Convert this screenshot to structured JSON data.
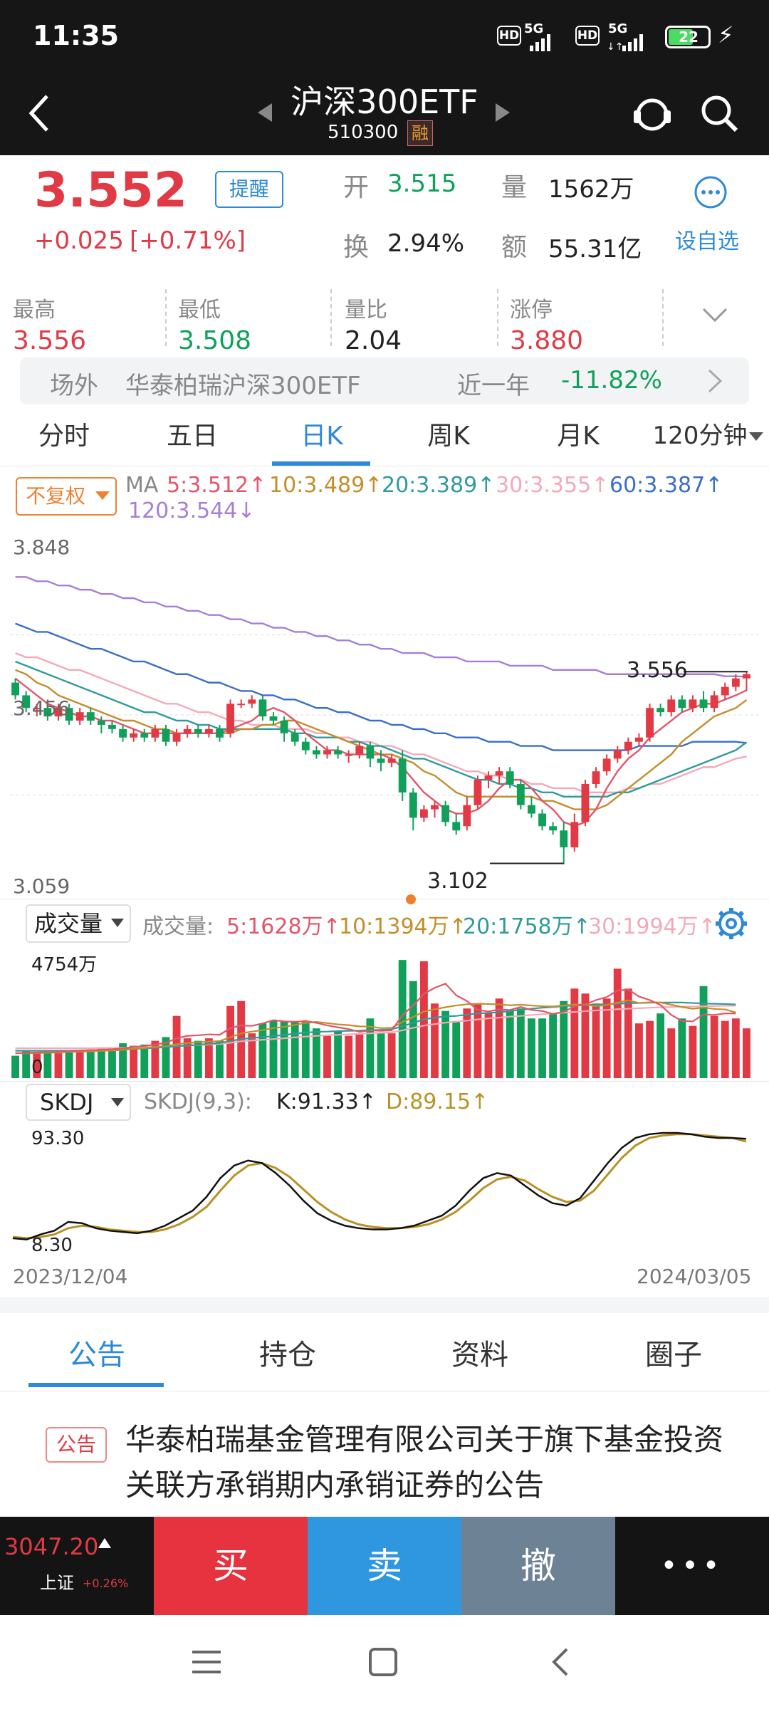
{
  "status_bar": {
    "time": "11:35",
    "signal1": "5G",
    "signal2": "5G",
    "hd": "HD",
    "battery": "22"
  },
  "header": {
    "title": "沪深300ETF",
    "code": "510300",
    "margin_badge": "融"
  },
  "quote": {
    "price": "3.552",
    "remind_button": "提醒",
    "change": "+0.025",
    "change_pct": "[+0.71%]",
    "open_label": "开",
    "open_value": "3.515",
    "volume_label": "量",
    "volume_value": "1562万",
    "turnover_label": "换",
    "turnover_value": "2.94%",
    "amount_label": "额",
    "amount_value": "55.31亿",
    "watchlist_label": "设自选"
  },
  "stats": [
    {
      "label": "最高",
      "value": "3.556",
      "color": "#e23a45"
    },
    {
      "label": "最低",
      "value": "3.508",
      "color": "#10a05a"
    },
    {
      "label": "量比",
      "value": "2.04",
      "color": "#222222"
    },
    {
      "label": "涨停",
      "value": "3.880",
      "color": "#e23a45"
    }
  ],
  "offsite": {
    "label": "场外",
    "name": "华泰柏瑞沪深300ETF",
    "period": "近一年",
    "return": "-11.82%"
  },
  "chart_tabs": [
    {
      "label": "分时"
    },
    {
      "label": "五日"
    },
    {
      "label": "日K"
    },
    {
      "label": "周K"
    },
    {
      "label": "月K"
    }
  ],
  "chart_tab_active": "日K",
  "chart_tab_more": "120分钟",
  "ma_bar": {
    "adjust": "不复权",
    "ma": "MA",
    "ma5": "5:3.512↑",
    "ma10": "10:3.489↑",
    "ma20": "20:3.389↑",
    "ma30": "30:3.355↑",
    "ma60": "60:3.387↑",
    "ma120": "120:3.544↓"
  },
  "price_axis": {
    "top": "3.848",
    "bottom": "3.059",
    "mid_label": "3.456"
  },
  "price_annotations": {
    "high": "3.556",
    "low": "3.102"
  },
  "volume_bar": {
    "selector": "成交量",
    "title": "成交量:",
    "v5": "5:1628万↑",
    "v10": "10:1394万↑",
    "v20": "20:1758万↑",
    "v30": "30:1994万↑",
    "max": "4754万",
    "zero": "0"
  },
  "skdj_bar": {
    "selector": "SKDJ",
    "params": "SKDJ(9,3):",
    "k": "K:91.33↑",
    "d": "D:89.15↑",
    "top": "93.30",
    "bottom": "8.30"
  },
  "date_axis": {
    "start": "2023/12/04",
    "end": "2024/03/05"
  },
  "chart_data": {
    "type": "candlestick",
    "x_start": "2023/12/04",
    "x_end": "2024/03/05",
    "ylim": [
      3.059,
      3.848
    ],
    "candles": [
      [
        3.53,
        3.5,
        3.54,
        3.49
      ],
      [
        3.5,
        3.47,
        3.51,
        3.46
      ],
      [
        3.47,
        3.47,
        3.48,
        3.45
      ],
      [
        3.47,
        3.45,
        3.49,
        3.44
      ],
      [
        3.45,
        3.47,
        3.48,
        3.44
      ],
      [
        3.47,
        3.44,
        3.48,
        3.43
      ],
      [
        3.44,
        3.46,
        3.47,
        3.43
      ],
      [
        3.46,
        3.44,
        3.47,
        3.43
      ],
      [
        3.44,
        3.43,
        3.45,
        3.41
      ],
      [
        3.43,
        3.42,
        3.44,
        3.41
      ],
      [
        3.42,
        3.4,
        3.43,
        3.39
      ],
      [
        3.4,
        3.41,
        3.42,
        3.39
      ],
      [
        3.41,
        3.4,
        3.42,
        3.39
      ],
      [
        3.4,
        3.42,
        3.43,
        3.39
      ],
      [
        3.42,
        3.39,
        3.43,
        3.38
      ],
      [
        3.39,
        3.41,
        3.42,
        3.38
      ],
      [
        3.41,
        3.42,
        3.43,
        3.4
      ],
      [
        3.42,
        3.41,
        3.43,
        3.4
      ],
      [
        3.41,
        3.42,
        3.43,
        3.4
      ],
      [
        3.42,
        3.4,
        3.43,
        3.39
      ],
      [
        3.41,
        3.48,
        3.49,
        3.4
      ],
      [
        3.48,
        3.48,
        3.49,
        3.47
      ],
      [
        3.48,
        3.49,
        3.5,
        3.47
      ],
      [
        3.49,
        3.45,
        3.5,
        3.44
      ],
      [
        3.45,
        3.44,
        3.46,
        3.43
      ],
      [
        3.44,
        3.41,
        3.45,
        3.39
      ],
      [
        3.41,
        3.39,
        3.42,
        3.38
      ],
      [
        3.39,
        3.37,
        3.4,
        3.36
      ],
      [
        3.37,
        3.36,
        3.38,
        3.35
      ],
      [
        3.36,
        3.37,
        3.38,
        3.35
      ],
      [
        3.37,
        3.36,
        3.38,
        3.35
      ],
      [
        3.36,
        3.36,
        3.37,
        3.34
      ],
      [
        3.36,
        3.38,
        3.39,
        3.35
      ],
      [
        3.38,
        3.35,
        3.39,
        3.33
      ],
      [
        3.35,
        3.34,
        3.37,
        3.32
      ],
      [
        3.34,
        3.35,
        3.36,
        3.33
      ],
      [
        3.35,
        3.27,
        3.37,
        3.25
      ],
      [
        3.27,
        3.21,
        3.28,
        3.18
      ],
      [
        3.21,
        3.23,
        3.24,
        3.2
      ],
      [
        3.23,
        3.24,
        3.25,
        3.21
      ],
      [
        3.24,
        3.2,
        3.25,
        3.19
      ],
      [
        3.2,
        3.18,
        3.22,
        3.17
      ],
      [
        3.19,
        3.24,
        3.26,
        3.18
      ],
      [
        3.24,
        3.3,
        3.31,
        3.23
      ],
      [
        3.3,
        3.31,
        3.32,
        3.28
      ],
      [
        3.31,
        3.32,
        3.33,
        3.29
      ],
      [
        3.32,
        3.29,
        3.33,
        3.28
      ],
      [
        3.29,
        3.24,
        3.3,
        3.23
      ],
      [
        3.24,
        3.22,
        3.26,
        3.21
      ],
      [
        3.22,
        3.19,
        3.23,
        3.18
      ],
      [
        3.19,
        3.18,
        3.2,
        3.17
      ],
      [
        3.18,
        3.14,
        3.2,
        3.1
      ],
      [
        3.14,
        3.2,
        3.22,
        3.13
      ],
      [
        3.2,
        3.29,
        3.3,
        3.19
      ],
      [
        3.29,
        3.32,
        3.33,
        3.28
      ],
      [
        3.32,
        3.35,
        3.36,
        3.31
      ],
      [
        3.35,
        3.37,
        3.38,
        3.34
      ],
      [
        3.37,
        3.39,
        3.4,
        3.36
      ],
      [
        3.39,
        3.4,
        3.41,
        3.38
      ],
      [
        3.4,
        3.47,
        3.48,
        3.39
      ],
      [
        3.47,
        3.46,
        3.48,
        3.45
      ],
      [
        3.46,
        3.49,
        3.5,
        3.45
      ],
      [
        3.49,
        3.47,
        3.5,
        3.46
      ],
      [
        3.47,
        3.49,
        3.5,
        3.46
      ],
      [
        3.49,
        3.47,
        3.51,
        3.46
      ],
      [
        3.47,
        3.5,
        3.51,
        3.46
      ],
      [
        3.5,
        3.52,
        3.53,
        3.49
      ],
      [
        3.52,
        3.54,
        3.55,
        3.51
      ],
      [
        3.54,
        3.55,
        3.556,
        3.51
      ]
    ],
    "ma5": [
      3.54,
      3.52,
      3.5,
      3.48,
      3.47,
      3.46,
      3.45,
      3.45,
      3.44,
      3.44,
      3.43,
      3.42,
      3.41,
      3.41,
      3.41,
      3.41,
      3.41,
      3.41,
      3.41,
      3.41,
      3.42,
      3.43,
      3.44,
      3.46,
      3.47,
      3.46,
      3.44,
      3.41,
      3.39,
      3.37,
      3.37,
      3.36,
      3.36,
      3.36,
      3.36,
      3.35,
      3.33,
      3.3,
      3.27,
      3.25,
      3.23,
      3.22,
      3.22,
      3.23,
      3.25,
      3.28,
      3.3,
      3.3,
      3.28,
      3.25,
      3.23,
      3.2,
      3.19,
      3.2,
      3.23,
      3.28,
      3.32,
      3.35,
      3.37,
      3.4,
      3.42,
      3.44,
      3.46,
      3.47,
      3.48,
      3.48,
      3.49,
      3.5,
      3.512
    ],
    "ma10": [
      3.56,
      3.55,
      3.53,
      3.52,
      3.5,
      3.49,
      3.48,
      3.47,
      3.46,
      3.45,
      3.44,
      3.44,
      3.43,
      3.42,
      3.42,
      3.41,
      3.41,
      3.41,
      3.41,
      3.41,
      3.41,
      3.42,
      3.42,
      3.43,
      3.43,
      3.44,
      3.44,
      3.43,
      3.42,
      3.41,
      3.4,
      3.39,
      3.38,
      3.37,
      3.36,
      3.36,
      3.35,
      3.34,
      3.32,
      3.31,
      3.29,
      3.27,
      3.26,
      3.26,
      3.26,
      3.26,
      3.26,
      3.26,
      3.26,
      3.25,
      3.25,
      3.24,
      3.23,
      3.23,
      3.23,
      3.24,
      3.26,
      3.28,
      3.3,
      3.32,
      3.34,
      3.36,
      3.39,
      3.41,
      3.43,
      3.45,
      3.46,
      3.47,
      3.489
    ],
    "ma20": [
      3.58,
      3.57,
      3.56,
      3.55,
      3.54,
      3.53,
      3.52,
      3.51,
      3.5,
      3.49,
      3.48,
      3.47,
      3.46,
      3.46,
      3.45,
      3.44,
      3.44,
      3.43,
      3.43,
      3.42,
      3.42,
      3.42,
      3.42,
      3.42,
      3.42,
      3.42,
      3.41,
      3.41,
      3.4,
      3.4,
      3.4,
      3.39,
      3.39,
      3.38,
      3.38,
      3.37,
      3.36,
      3.35,
      3.35,
      3.34,
      3.33,
      3.32,
      3.31,
      3.3,
      3.3,
      3.29,
      3.29,
      3.28,
      3.28,
      3.27,
      3.27,
      3.26,
      3.26,
      3.26,
      3.26,
      3.26,
      3.27,
      3.27,
      3.28,
      3.29,
      3.3,
      3.31,
      3.32,
      3.33,
      3.34,
      3.35,
      3.36,
      3.37,
      3.389
    ],
    "ma30": [
      3.6,
      3.59,
      3.59,
      3.58,
      3.57,
      3.56,
      3.56,
      3.55,
      3.54,
      3.53,
      3.52,
      3.51,
      3.5,
      3.49,
      3.48,
      3.48,
      3.47,
      3.46,
      3.46,
      3.45,
      3.44,
      3.44,
      3.43,
      3.43,
      3.43,
      3.42,
      3.42,
      3.42,
      3.41,
      3.41,
      3.4,
      3.4,
      3.39,
      3.39,
      3.38,
      3.38,
      3.37,
      3.36,
      3.36,
      3.35,
      3.34,
      3.33,
      3.32,
      3.32,
      3.31,
      3.31,
      3.3,
      3.3,
      3.29,
      3.29,
      3.28,
      3.28,
      3.28,
      3.27,
      3.27,
      3.27,
      3.27,
      3.28,
      3.28,
      3.29,
      3.29,
      3.3,
      3.31,
      3.32,
      3.33,
      3.33,
      3.34,
      3.35,
      3.355
    ],
    "ma60": [
      3.67,
      3.66,
      3.65,
      3.65,
      3.64,
      3.63,
      3.62,
      3.61,
      3.61,
      3.6,
      3.59,
      3.58,
      3.58,
      3.57,
      3.56,
      3.55,
      3.55,
      3.54,
      3.53,
      3.53,
      3.52,
      3.51,
      3.51,
      3.5,
      3.5,
      3.49,
      3.49,
      3.48,
      3.47,
      3.47,
      3.46,
      3.46,
      3.45,
      3.44,
      3.44,
      3.43,
      3.43,
      3.42,
      3.42,
      3.41,
      3.41,
      3.4,
      3.4,
      3.4,
      3.39,
      3.39,
      3.39,
      3.38,
      3.38,
      3.38,
      3.37,
      3.37,
      3.37,
      3.37,
      3.37,
      3.37,
      3.37,
      3.37,
      3.38,
      3.38,
      3.38,
      3.38,
      3.38,
      3.39,
      3.39,
      3.39,
      3.39,
      3.39,
      3.387
    ],
    "ma120": [
      3.78,
      3.78,
      3.77,
      3.77,
      3.76,
      3.76,
      3.75,
      3.75,
      3.74,
      3.74,
      3.73,
      3.73,
      3.72,
      3.72,
      3.71,
      3.71,
      3.7,
      3.7,
      3.69,
      3.69,
      3.68,
      3.68,
      3.67,
      3.67,
      3.66,
      3.66,
      3.65,
      3.65,
      3.64,
      3.64,
      3.63,
      3.63,
      3.62,
      3.62,
      3.61,
      3.61,
      3.6,
      3.6,
      3.6,
      3.59,
      3.59,
      3.59,
      3.58,
      3.58,
      3.58,
      3.58,
      3.57,
      3.57,
      3.57,
      3.57,
      3.56,
      3.56,
      3.56,
      3.56,
      3.56,
      3.55,
      3.55,
      3.55,
      3.55,
      3.55,
      3.55,
      3.55,
      3.55,
      3.55,
      3.55,
      3.55,
      3.545,
      3.545,
      3.544
    ],
    "volumes": [
      900,
      1100,
      1000,
      1100,
      1000,
      1100,
      1050,
      1150,
      1200,
      1200,
      1400,
      1300,
      1350,
      1500,
      1650,
      2500,
      1600,
      1500,
      1600,
      1500,
      2900,
      3100,
      1800,
      2200,
      2300,
      2300,
      2300,
      2300,
      2000,
      1700,
      1900,
      1700,
      1800,
      2400,
      1800,
      1800,
      4750,
      3900,
      4700,
      3000,
      2700,
      2300,
      2800,
      3000,
      2600,
      3200,
      2700,
      2800,
      2400,
      2400,
      2600,
      3100,
      3600,
      3400,
      3000,
      3200,
      4400,
      3600,
      2200,
      2300,
      2600,
      2000,
      2400,
      2100,
      3700,
      2500,
      2300,
      2400,
      2000
    ],
    "vol_ma5": [
      1000,
      1010,
      1030,
      1050,
      1060,
      1080,
      1100,
      1120,
      1140,
      1160,
      1200,
      1250,
      1290,
      1350,
      1420,
      1600,
      1700,
      1720,
      1760,
      1740,
      2010,
      2120,
      2100,
      2200,
      2330,
      2280,
      2260,
      2300,
      2220,
      2120,
      2040,
      1970,
      1860,
      1920,
      1900,
      1920,
      2530,
      2920,
      3390,
      3630,
      3800,
      3330,
      3100,
      2740,
      2680,
      2760,
      2740,
      2860,
      2740,
      2700,
      2580,
      2660,
      2890,
      2960,
      3140,
      3260,
      3520,
      3560,
      3280,
      3140,
      2940,
      2540,
      2300,
      2280,
      2560,
      2540,
      2600,
      2600,
      1628
    ],
    "vol_ma10": [
      1000,
      1000,
      1010,
      1020,
      1030,
      1050,
      1060,
      1080,
      1100,
      1110,
      1130,
      1170,
      1210,
      1250,
      1290,
      1360,
      1410,
      1440,
      1470,
      1490,
      1640,
      1800,
      1870,
      1930,
      2010,
      2060,
      2140,
      2220,
      2260,
      2210,
      2160,
      2130,
      2080,
      2070,
      2010,
      2020,
      2250,
      2460,
      2680,
      2770,
      2850,
      2920,
      2970,
      2990,
      2980,
      2960,
      2930,
      2950,
      2920,
      2890,
      2880,
      2920,
      2960,
      2960,
      2890,
      2940,
      3030,
      3130,
      3020,
      3050,
      3040,
      2950,
      2860,
      2790,
      2840,
      2780,
      2760,
      2640,
      1394
    ],
    "vol_ma20": [
      1100,
      1100,
      1100,
      1100,
      1100,
      1100,
      1110,
      1120,
      1130,
      1140,
      1150,
      1170,
      1190,
      1220,
      1240,
      1280,
      1310,
      1340,
      1380,
      1410,
      1490,
      1570,
      1610,
      1650,
      1690,
      1740,
      1790,
      1830,
      1860,
      1870,
      1890,
      1900,
      1910,
      1930,
      1940,
      1960,
      2090,
      2220,
      2360,
      2430,
      2480,
      2500,
      2550,
      2600,
      2620,
      2650,
      2700,
      2750,
      2790,
      2830,
      2860,
      2890,
      2920,
      2940,
      2960,
      2970,
      2990,
      3010,
      3020,
      3030,
      3040,
      3040,
      3040,
      3020,
      3000,
      2990,
      2980,
      2960,
      1758
    ],
    "vol_ma30": [
      1200,
      1200,
      1200,
      1200,
      1200,
      1200,
      1200,
      1200,
      1210,
      1210,
      1220,
      1230,
      1240,
      1250,
      1270,
      1290,
      1310,
      1330,
      1350,
      1370,
      1420,
      1480,
      1510,
      1540,
      1570,
      1600,
      1640,
      1670,
      1700,
      1720,
      1740,
      1760,
      1780,
      1800,
      1820,
      1840,
      1920,
      2020,
      2110,
      2170,
      2230,
      2270,
      2310,
      2360,
      2400,
      2430,
      2470,
      2500,
      2540,
      2570,
      2600,
      2630,
      2660,
      2690,
      2720,
      2740,
      2770,
      2790,
      2810,
      2830,
      2850,
      2860,
      2870,
      2880,
      2890,
      2900,
      2910,
      2910,
      1994
    ],
    "skdj_k": [
      12,
      11,
      15,
      18,
      25,
      24,
      20,
      18,
      17,
      16,
      18,
      22,
      28,
      34,
      45,
      60,
      70,
      74,
      72,
      64,
      54,
      42,
      32,
      26,
      22,
      20,
      19,
      19,
      20,
      22,
      26,
      30,
      38,
      50,
      60,
      64,
      62,
      54,
      46,
      40,
      38,
      44,
      58,
      72,
      84,
      92,
      95,
      96,
      96,
      95,
      93,
      92,
      92,
      91.33
    ],
    "skdj_d": [
      13,
      12,
      13,
      15,
      20,
      22,
      21,
      19,
      18,
      17,
      17,
      19,
      23,
      29,
      37,
      50,
      62,
      70,
      72,
      68,
      61,
      51,
      41,
      33,
      27,
      23,
      21,
      20,
      20,
      21,
      23,
      27,
      33,
      42,
      52,
      59,
      61,
      58,
      51,
      45,
      41,
      42,
      50,
      63,
      76,
      86,
      92,
      94,
      95,
      95,
      94,
      93,
      92,
      89.15
    ],
    "annotations": {
      "high": 3.556,
      "low": 3.102
    }
  },
  "bottom_tabs": [
    {
      "label": "公告"
    },
    {
      "label": "持仓"
    },
    {
      "label": "资料"
    },
    {
      "label": "圈子"
    }
  ],
  "bottom_tab_active": "公告",
  "announcement": {
    "tag": "公告",
    "title": "华泰柏瑞基金管理有限公司关于旗下基金投资关联方承销期内承销证券的公告"
  },
  "index_ticker": {
    "value": "3047.20",
    "name": "上证",
    "pct": "+0.26%"
  },
  "trade_buttons": {
    "buy": "买",
    "sell": "卖",
    "cancel": "撤",
    "more": "•••"
  },
  "colors": {
    "up": "#e23a45",
    "down": "#10a05a",
    "accent": "#2e89d8",
    "ma5": "#e2566a",
    "ma10": "#c48d2a",
    "ma20": "#2f9b9b",
    "ma30": "#f4a9b8",
    "ma60": "#3a6ec8",
    "ma120": "#a57fd8"
  }
}
